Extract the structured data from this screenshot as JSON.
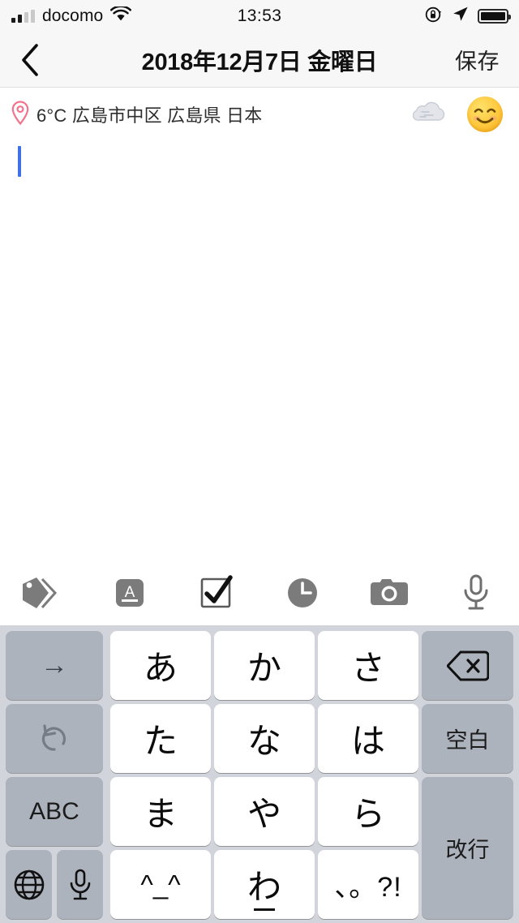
{
  "status_bar": {
    "carrier": "docomo",
    "time": "13:53",
    "signal_icon": "signal-bars-icon",
    "signal_bars_filled": 2,
    "signal_bars_total": 4,
    "wifi_icon": "wifi-icon",
    "rotation_lock_icon": "rotation-lock-icon",
    "location_icon": "location-arrow-icon",
    "battery_icon": "battery-full-icon",
    "battery_level_percent": 100
  },
  "navbar": {
    "back_icon": "chevron-left-icon",
    "title": "2018年12月7日 金曜日",
    "save_label": "保存"
  },
  "meta": {
    "pin_icon": "map-pin-icon",
    "pin_color": "#f2748c",
    "text": "6°C 広島市中区 広島県 日本",
    "temperature": "6°C",
    "location": "広島市中区 広島県 日本",
    "weather_icon": "cloud-icon",
    "mood_icon": "smiling-face-emoji"
  },
  "note": {
    "body_text": "",
    "caret_color": "#3f71ea"
  },
  "toolbar": {
    "items": [
      {
        "name": "tag-icon",
        "label": "タグ"
      },
      {
        "name": "text-format-icon",
        "label": "書式"
      },
      {
        "name": "checkbox-icon",
        "label": "チェックリスト"
      },
      {
        "name": "clock-icon",
        "label": "時刻"
      },
      {
        "name": "camera-icon",
        "label": "カメラ"
      },
      {
        "name": "microphone-icon",
        "label": "音声入力"
      }
    ]
  },
  "keyboard": {
    "type": "japanese-kana-12key",
    "background_color": "#d1d4da",
    "key_white_color": "#ffffff",
    "key_gray_color": "#adb3bd",
    "keys": {
      "cursor_right": "→",
      "undo": "↺",
      "abc": "ABC",
      "globe_icon": "globe-icon",
      "mic_icon": "microphone-icon",
      "a": "あ",
      "ka": "か",
      "sa": "さ",
      "ta": "た",
      "na": "な",
      "ha": "は",
      "ma": "ま",
      "ya": "や",
      "ra": "ら",
      "emoticon": "^_^",
      "wa": "わ",
      "punctuation": "、。?!",
      "delete_icon": "delete-backspace-icon",
      "space": "空白",
      "return": "改行"
    }
  }
}
